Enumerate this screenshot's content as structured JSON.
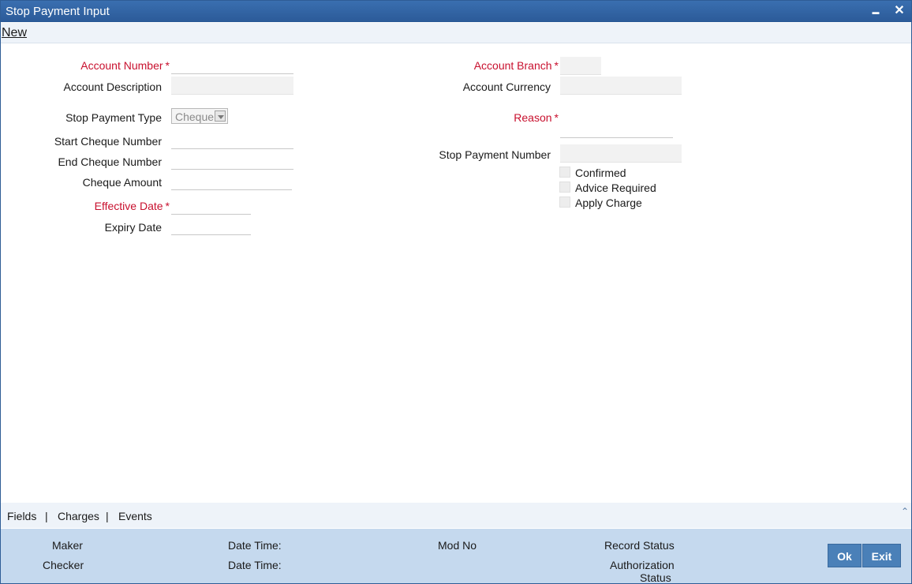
{
  "window": {
    "title": "Stop Payment Input",
    "minimize_glyph": "▬",
    "close_glyph": "✕"
  },
  "menu": {
    "new_label": "New"
  },
  "form": {
    "account_number": {
      "label": "Account Number",
      "value": ""
    },
    "account_description": {
      "label": "Account Description",
      "value": ""
    },
    "stop_payment_type": {
      "label": "Stop Payment Type",
      "selected": "Cheque"
    },
    "start_cheque_number": {
      "label": "Start Cheque Number",
      "value": ""
    },
    "end_cheque_number": {
      "label": "End Cheque Number",
      "value": ""
    },
    "cheque_amount": {
      "label": "Cheque Amount",
      "value": ""
    },
    "effective_date": {
      "label": "Effective Date",
      "value": ""
    },
    "expiry_date": {
      "label": "Expiry Date",
      "value": ""
    },
    "account_branch": {
      "label": "Account Branch",
      "value": ""
    },
    "account_currency": {
      "label": "Account Currency",
      "value": ""
    },
    "reason": {
      "label": "Reason",
      "value": ""
    },
    "stop_payment_number": {
      "label": "Stop Payment Number",
      "value": ""
    },
    "required_marker": "*",
    "checkboxes": {
      "confirmed": {
        "label": "Confirmed",
        "checked": false
      },
      "advice_required": {
        "label": "Advice Required",
        "checked": false
      },
      "apply_charge": {
        "label": "Apply Charge",
        "checked": false
      }
    }
  },
  "tabs": {
    "fields": "Fields",
    "charges": "Charges",
    "events": "Events",
    "separator": "|"
  },
  "footer": {
    "maker": "Maker",
    "checker": "Checker",
    "date_time_1": "Date Time:",
    "date_time_2": "Date Time:",
    "mod_no": "Mod No",
    "record_status": "Record Status",
    "authorization": "Authorization",
    "status": "Status",
    "ok": "Ok",
    "exit": "Exit"
  },
  "colors": {
    "title_bar": "#2b5a98",
    "required": "#c8102e",
    "footer_bg": "#c5d9ee",
    "button_bg": "#4a80b8"
  }
}
